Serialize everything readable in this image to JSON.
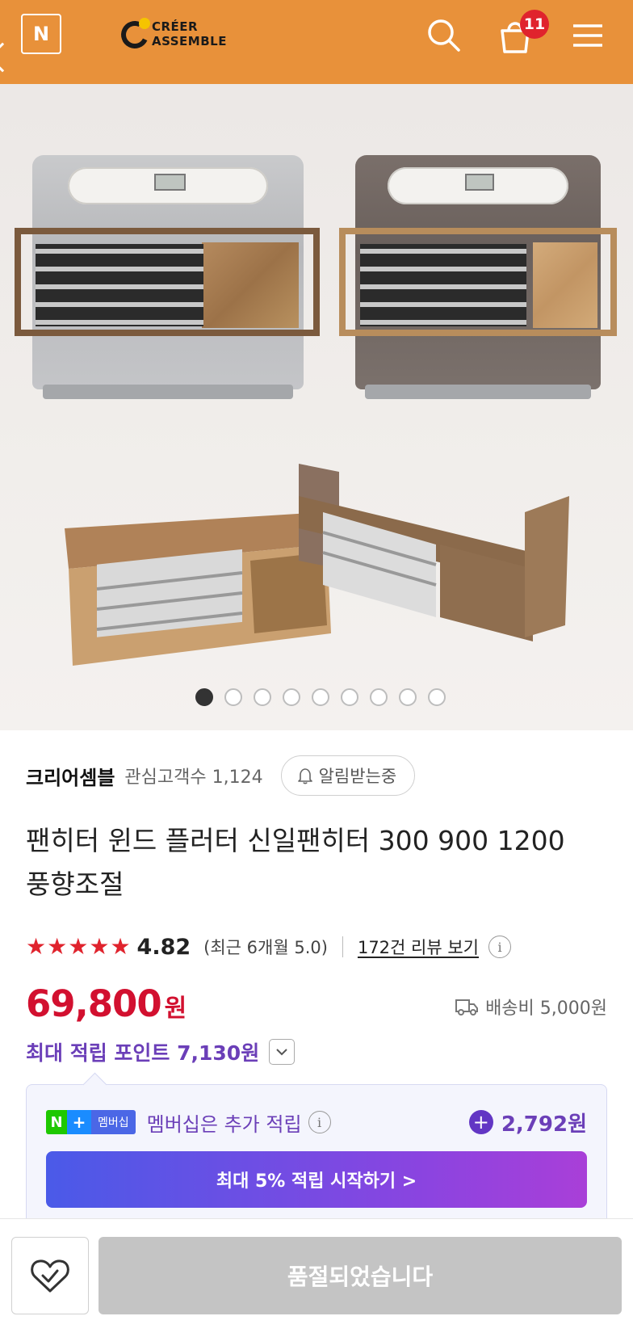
{
  "header": {
    "n_badge": "N",
    "logo_line1": "CRÉER",
    "logo_line2": "ASSEMBLE",
    "cart_count": "11",
    "background_color": "#e8913a"
  },
  "gallery": {
    "total_images": 9,
    "active_index": 0
  },
  "seller": {
    "name": "크리어셈블",
    "fans_label": "관심고객수 1,124",
    "alarm_label": "알림받는중"
  },
  "product": {
    "title": "팬히터 윈드 플러터 신일팬히터 300 900 1200 풍향조절"
  },
  "rating": {
    "stars": 5,
    "value": "4.82",
    "recent": "(최근 6개월 5.0)",
    "review_link": "172건 리뷰 보기"
  },
  "price": {
    "amount": "69,800",
    "unit": "원",
    "color": "#d2102f"
  },
  "shipping": {
    "label": "배송비 5,000원"
  },
  "points": {
    "label": "최대 적립 포인트 7,130원"
  },
  "membership": {
    "badge_n": "N",
    "badge_plus": "+",
    "badge_label": "멤버십",
    "text": "멤버십은 추가 적립",
    "bonus_amount": "2,792원",
    "cta_label": "최대 5% 적립 시작하기 >"
  },
  "bottom": {
    "soldout_label": "품절되었습니다"
  }
}
